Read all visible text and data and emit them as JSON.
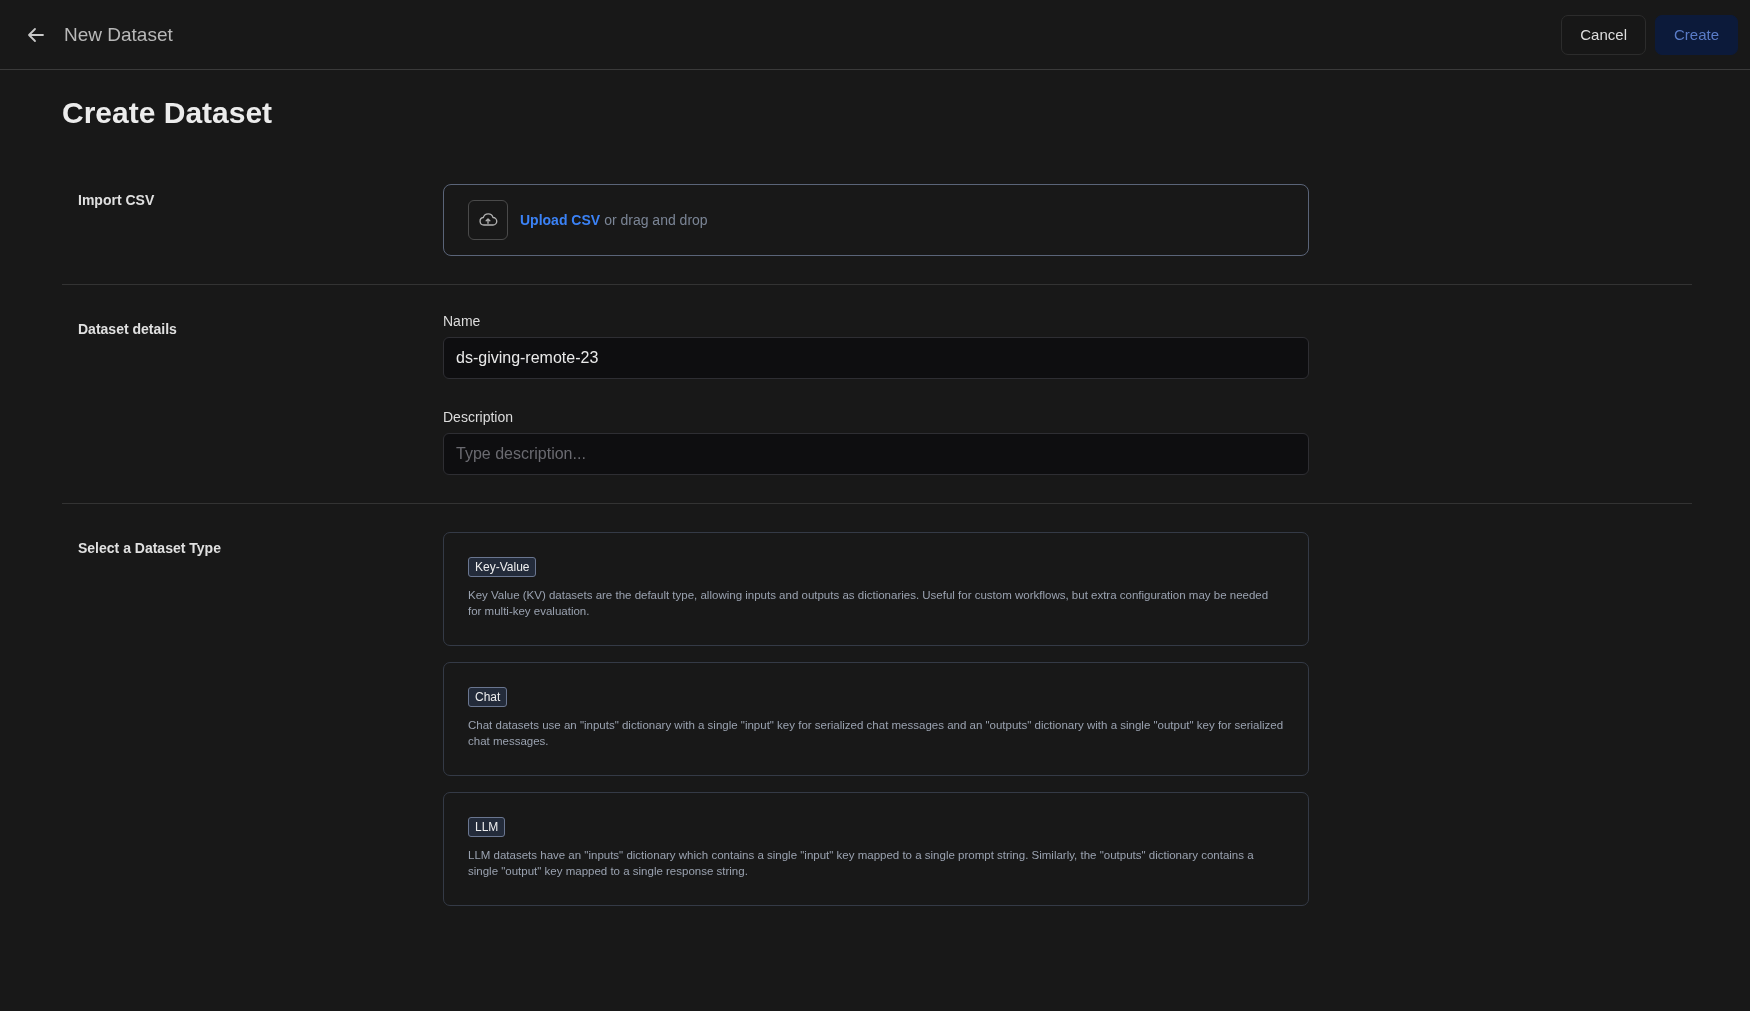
{
  "header": {
    "title": "New Dataset",
    "buttons": [
      {
        "label": "Cancel",
        "kind": "secondary",
        "disabled": false
      },
      {
        "label": "Create",
        "kind": "primary",
        "disabled": true
      }
    ]
  },
  "page_title": "Create Dataset",
  "import_section": {
    "label": "Import CSV",
    "upload_link": "Upload CSV",
    "upload_hint": "or drag and drop"
  },
  "details_section": {
    "label": "Dataset details",
    "fields": [
      {
        "label": "Name",
        "value": "ds-giving-remote-23"
      },
      {
        "label": "Description",
        "placeholder": "Type description..."
      }
    ]
  },
  "type_section": {
    "label": "Select a Dataset Type",
    "types": [
      {
        "badge": "Key-Value",
        "description": "Key Value (KV) datasets are the default type, allowing inputs and outputs as dictionaries. Useful for custom workflows, but extra configuration may be needed for multi-key evaluation.",
        "selected": false
      },
      {
        "badge": "Chat",
        "description": "Chat datasets use an \"inputs\" dictionary with a single \"input\" key for serialized chat messages and an \"outputs\" dictionary with a single \"output\" key for serialized chat messages.",
        "selected": false
      },
      {
        "badge": "LLM",
        "description": "LLM datasets have an \"inputs\" dictionary which contains a single \"input\" key mapped to a single prompt string. Similarly, the \"outputs\" dictionary contains a single \"output\" key mapped to a single response string.",
        "selected": false
      }
    ]
  }
}
